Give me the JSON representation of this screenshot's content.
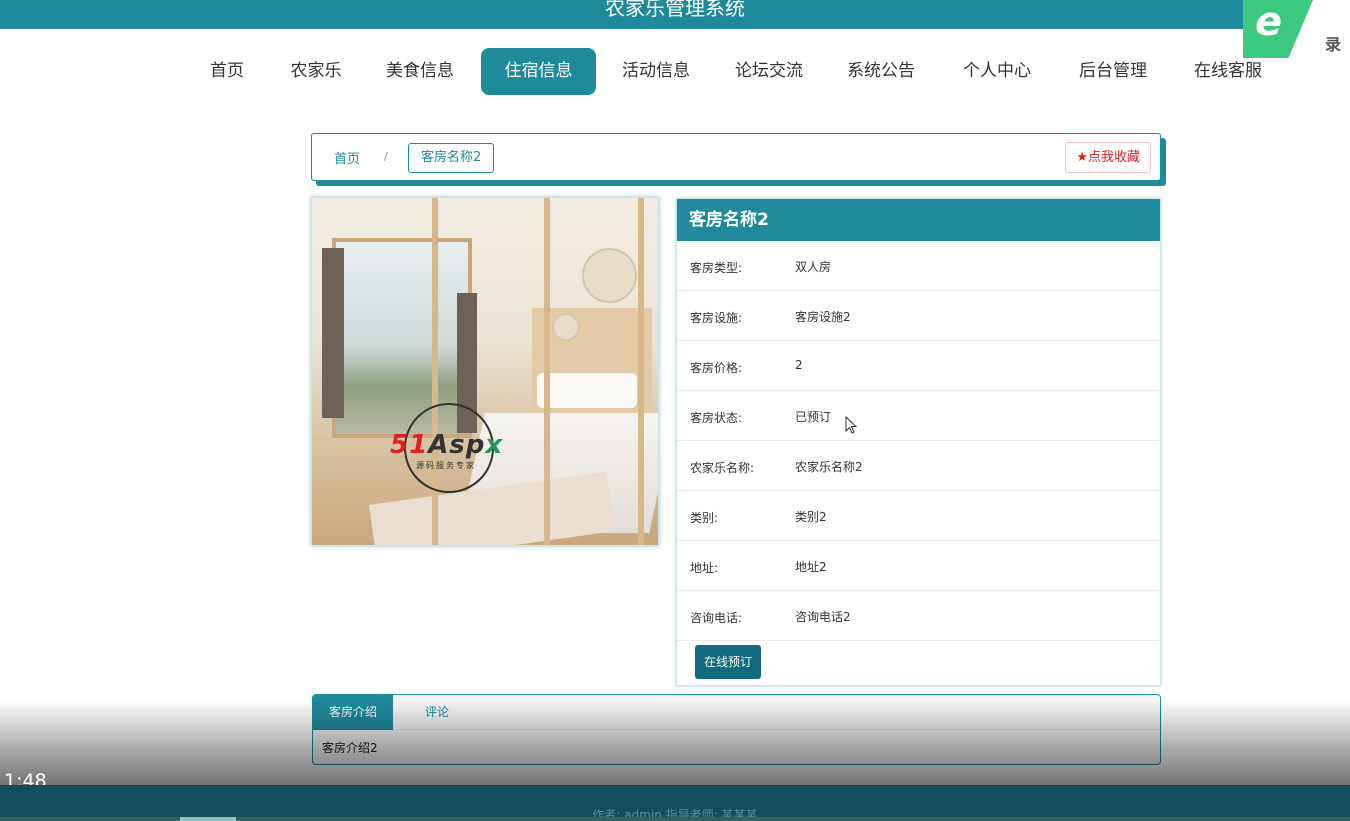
{
  "header": {
    "title": "农家乐管理系统"
  },
  "badge": {
    "icon": "e",
    "text": "录制"
  },
  "nav": {
    "items": [
      {
        "label": "首页",
        "active": false
      },
      {
        "label": "农家乐",
        "active": false
      },
      {
        "label": "美食信息",
        "active": false
      },
      {
        "label": "住宿信息",
        "active": true
      },
      {
        "label": "活动信息",
        "active": false
      },
      {
        "label": "论坛交流",
        "active": false
      },
      {
        "label": "系统公告",
        "active": false
      },
      {
        "label": "个人中心",
        "active": false
      },
      {
        "label": "后台管理",
        "active": false
      },
      {
        "label": "在线客服",
        "active": false
      }
    ]
  },
  "breadcrumb": {
    "home": "首页",
    "separator": "/",
    "current": "客房名称2"
  },
  "favorite": {
    "label": "点我收藏",
    "icon": "star-icon"
  },
  "watermark": {
    "brand_a": "51",
    "brand_b": "Asp",
    "brand_c": "x",
    "sub": "源码服务专家"
  },
  "detail": {
    "title": "客房名称2",
    "fields": [
      {
        "label": "客房类型:",
        "value": "双人房"
      },
      {
        "label": "客房设施:",
        "value": "客房设施2"
      },
      {
        "label": "客房价格:",
        "value": "2"
      },
      {
        "label": "客房状态:",
        "value": "已预订"
      },
      {
        "label": "农家乐名称:",
        "value": "农家乐名称2"
      },
      {
        "label": "类别:",
        "value": "类别2"
      },
      {
        "label": "地址:",
        "value": "地址2"
      },
      {
        "label": "咨询电话:",
        "value": "咨询电话2"
      }
    ],
    "book_button": "在线预订"
  },
  "tabs": {
    "items": [
      {
        "label": "客房介绍",
        "active": true
      },
      {
        "label": "评论",
        "active": false
      }
    ],
    "content": "客房介绍2"
  },
  "video": {
    "timecode": "1:48"
  },
  "footer": {
    "text": "作者: admin 指导老师: 某某某"
  },
  "colors": {
    "primary": "#1e8a9c",
    "dark": "#116a7d",
    "favorite": "#e02020"
  }
}
